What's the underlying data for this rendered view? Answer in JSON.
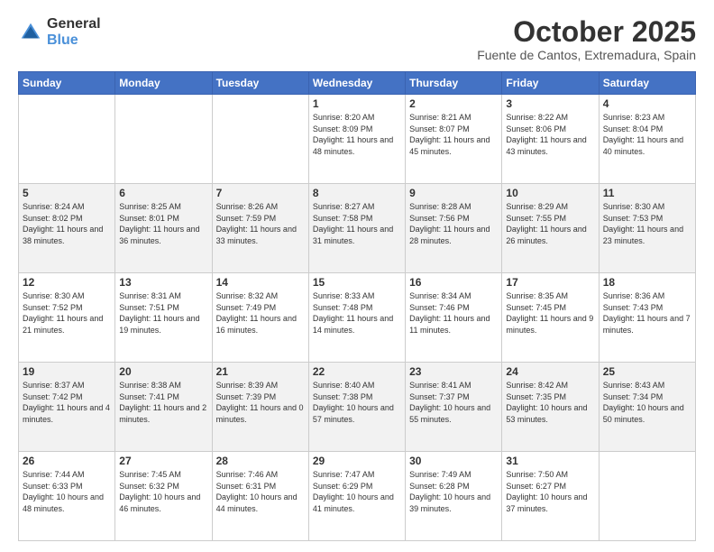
{
  "logo": {
    "general": "General",
    "blue": "Blue"
  },
  "header": {
    "month": "October 2025",
    "location": "Fuente de Cantos, Extremadura, Spain"
  },
  "weekdays": [
    "Sunday",
    "Monday",
    "Tuesday",
    "Wednesday",
    "Thursday",
    "Friday",
    "Saturday"
  ],
  "weeks": [
    [
      {
        "day": null
      },
      {
        "day": null
      },
      {
        "day": null
      },
      {
        "day": 1,
        "sunrise": "8:20 AM",
        "sunset": "8:09 PM",
        "daylight": "11 hours and 48 minutes."
      },
      {
        "day": 2,
        "sunrise": "8:21 AM",
        "sunset": "8:07 PM",
        "daylight": "11 hours and 45 minutes."
      },
      {
        "day": 3,
        "sunrise": "8:22 AM",
        "sunset": "8:06 PM",
        "daylight": "11 hours and 43 minutes."
      },
      {
        "day": 4,
        "sunrise": "8:23 AM",
        "sunset": "8:04 PM",
        "daylight": "11 hours and 40 minutes."
      }
    ],
    [
      {
        "day": 5,
        "sunrise": "8:24 AM",
        "sunset": "8:02 PM",
        "daylight": "11 hours and 38 minutes."
      },
      {
        "day": 6,
        "sunrise": "8:25 AM",
        "sunset": "8:01 PM",
        "daylight": "11 hours and 36 minutes."
      },
      {
        "day": 7,
        "sunrise": "8:26 AM",
        "sunset": "7:59 PM",
        "daylight": "11 hours and 33 minutes."
      },
      {
        "day": 8,
        "sunrise": "8:27 AM",
        "sunset": "7:58 PM",
        "daylight": "11 hours and 31 minutes."
      },
      {
        "day": 9,
        "sunrise": "8:28 AM",
        "sunset": "7:56 PM",
        "daylight": "11 hours and 28 minutes."
      },
      {
        "day": 10,
        "sunrise": "8:29 AM",
        "sunset": "7:55 PM",
        "daylight": "11 hours and 26 minutes."
      },
      {
        "day": 11,
        "sunrise": "8:30 AM",
        "sunset": "7:53 PM",
        "daylight": "11 hours and 23 minutes."
      }
    ],
    [
      {
        "day": 12,
        "sunrise": "8:30 AM",
        "sunset": "7:52 PM",
        "daylight": "11 hours and 21 minutes."
      },
      {
        "day": 13,
        "sunrise": "8:31 AM",
        "sunset": "7:51 PM",
        "daylight": "11 hours and 19 minutes."
      },
      {
        "day": 14,
        "sunrise": "8:32 AM",
        "sunset": "7:49 PM",
        "daylight": "11 hours and 16 minutes."
      },
      {
        "day": 15,
        "sunrise": "8:33 AM",
        "sunset": "7:48 PM",
        "daylight": "11 hours and 14 minutes."
      },
      {
        "day": 16,
        "sunrise": "8:34 AM",
        "sunset": "7:46 PM",
        "daylight": "11 hours and 11 minutes."
      },
      {
        "day": 17,
        "sunrise": "8:35 AM",
        "sunset": "7:45 PM",
        "daylight": "11 hours and 9 minutes."
      },
      {
        "day": 18,
        "sunrise": "8:36 AM",
        "sunset": "7:43 PM",
        "daylight": "11 hours and 7 minutes."
      }
    ],
    [
      {
        "day": 19,
        "sunrise": "8:37 AM",
        "sunset": "7:42 PM",
        "daylight": "11 hours and 4 minutes."
      },
      {
        "day": 20,
        "sunrise": "8:38 AM",
        "sunset": "7:41 PM",
        "daylight": "11 hours and 2 minutes."
      },
      {
        "day": 21,
        "sunrise": "8:39 AM",
        "sunset": "7:39 PM",
        "daylight": "11 hours and 0 minutes."
      },
      {
        "day": 22,
        "sunrise": "8:40 AM",
        "sunset": "7:38 PM",
        "daylight": "10 hours and 57 minutes."
      },
      {
        "day": 23,
        "sunrise": "8:41 AM",
        "sunset": "7:37 PM",
        "daylight": "10 hours and 55 minutes."
      },
      {
        "day": 24,
        "sunrise": "8:42 AM",
        "sunset": "7:35 PM",
        "daylight": "10 hours and 53 minutes."
      },
      {
        "day": 25,
        "sunrise": "8:43 AM",
        "sunset": "7:34 PM",
        "daylight": "10 hours and 50 minutes."
      }
    ],
    [
      {
        "day": 26,
        "sunrise": "7:44 AM",
        "sunset": "6:33 PM",
        "daylight": "10 hours and 48 minutes."
      },
      {
        "day": 27,
        "sunrise": "7:45 AM",
        "sunset": "6:32 PM",
        "daylight": "10 hours and 46 minutes."
      },
      {
        "day": 28,
        "sunrise": "7:46 AM",
        "sunset": "6:31 PM",
        "daylight": "10 hours and 44 minutes."
      },
      {
        "day": 29,
        "sunrise": "7:47 AM",
        "sunset": "6:29 PM",
        "daylight": "10 hours and 41 minutes."
      },
      {
        "day": 30,
        "sunrise": "7:49 AM",
        "sunset": "6:28 PM",
        "daylight": "10 hours and 39 minutes."
      },
      {
        "day": 31,
        "sunrise": "7:50 AM",
        "sunset": "6:27 PM",
        "daylight": "10 hours and 37 minutes."
      },
      {
        "day": null
      }
    ]
  ]
}
